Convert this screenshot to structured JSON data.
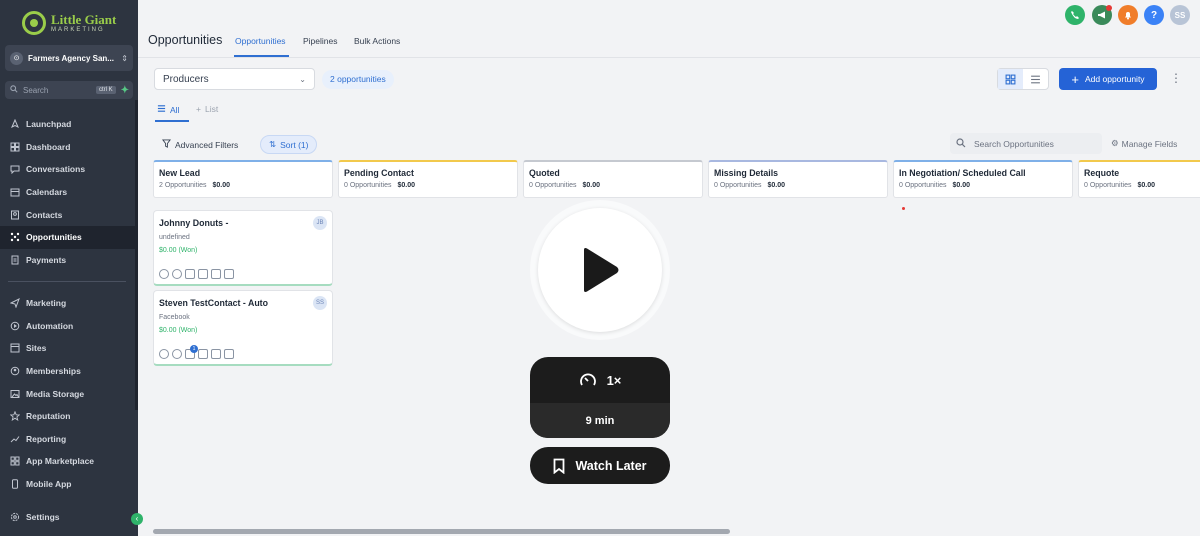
{
  "brand": {
    "name": "Little Giant",
    "tagline": "MARKETING"
  },
  "account": {
    "name": "Farmers Agency San..."
  },
  "sidebar_search": {
    "placeholder": "Search",
    "shortcut": "ctrl K"
  },
  "nav_top": [
    {
      "label": "Launchpad",
      "icon": "rocket-icon"
    },
    {
      "label": "Dashboard",
      "icon": "dashboard-icon"
    },
    {
      "label": "Conversations",
      "icon": "chat-icon"
    },
    {
      "label": "Calendars",
      "icon": "calendar-icon"
    },
    {
      "label": "Contacts",
      "icon": "contacts-icon"
    },
    {
      "label": "Opportunities",
      "icon": "opportunities-icon",
      "active": true
    },
    {
      "label": "Payments",
      "icon": "payments-icon"
    }
  ],
  "nav_bottom": [
    {
      "label": "Marketing",
      "icon": "send-icon"
    },
    {
      "label": "Automation",
      "icon": "automation-icon"
    },
    {
      "label": "Sites",
      "icon": "sites-icon"
    },
    {
      "label": "Memberships",
      "icon": "memberships-icon"
    },
    {
      "label": "Media Storage",
      "icon": "media-icon"
    },
    {
      "label": "Reputation",
      "icon": "star-icon"
    },
    {
      "label": "Reporting",
      "icon": "chart-icon"
    },
    {
      "label": "App Marketplace",
      "icon": "apps-icon"
    },
    {
      "label": "Mobile App",
      "icon": "mobile-icon"
    }
  ],
  "settings_label": "Settings",
  "header": {
    "title": "Opportunities",
    "tabs": [
      "Opportunities",
      "Pipelines",
      "Bulk Actions"
    ],
    "avatar_initials": "SS",
    "help": "?"
  },
  "toolbar": {
    "pipeline": "Producers",
    "count": "2 opportunities",
    "add_label": "Add opportunity",
    "tab_all": "All",
    "tab_list": "List",
    "filters_label": "Advanced Filters",
    "sort_label": "Sort (1)",
    "search_placeholder": "Search Opportunities",
    "manage_fields": "Manage Fields"
  },
  "columns": [
    {
      "title": "New Lead",
      "count": "2 Opportunities",
      "value": "$0.00"
    },
    {
      "title": "Pending Contact",
      "count": "0 Opportunities",
      "value": "$0.00"
    },
    {
      "title": "Quoted",
      "count": "0 Opportunities",
      "value": "$0.00"
    },
    {
      "title": "Missing Details",
      "count": "0 Opportunities",
      "value": "$0.00"
    },
    {
      "title": "In Negotiation/ Scheduled Call",
      "count": "0 Opportunities",
      "value": "$0.00"
    },
    {
      "title": "Requote",
      "count": "0 Opportunities",
      "value": "$0.00"
    }
  ],
  "cards": [
    {
      "name": "Johnny Donuts -",
      "source": "undefined",
      "value": "$0.00 (Won)",
      "avatar": "JB",
      "badge": ""
    },
    {
      "name": "Steven TestContact - Auto",
      "source": "Facebook",
      "value": "$0.00 (Won)",
      "avatar": "SS",
      "badge": "1"
    }
  ],
  "video": {
    "speed": "1×",
    "duration": "9 min",
    "watch_later": "Watch Later"
  },
  "colors": {
    "primary": "#2563d6",
    "sidebar": "#2d3440",
    "won": "#2fb36a"
  }
}
